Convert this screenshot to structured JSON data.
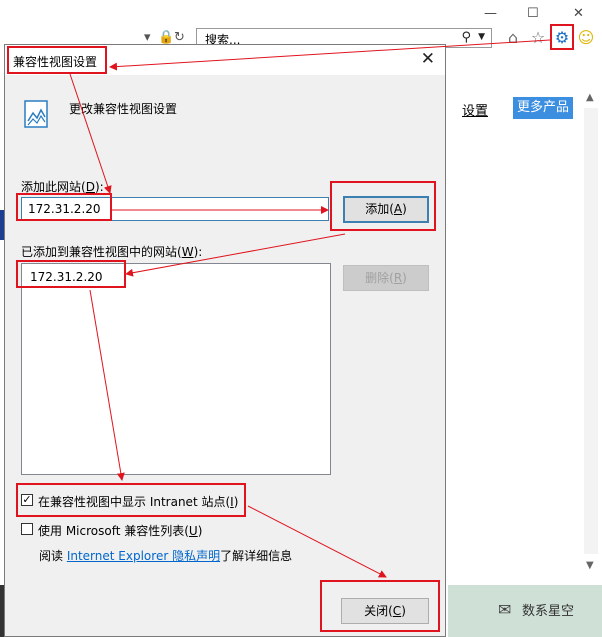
{
  "browser": {
    "address_text": "搜索...",
    "minimize_glyph": "—",
    "maximize_glyph": "☐",
    "close_glyph": "✕",
    "home_icon": "home-icon",
    "star_icon": "star-icon",
    "gear_icon": "gear-icon",
    "smiley_icon": "smiley-icon",
    "settings_link": "设置",
    "more_products": "更多产品",
    "watermark_text": "数系星空"
  },
  "dialog": {
    "title": "兼容性视图设置",
    "header_text": "更改兼容性视图设置",
    "add_site": {
      "label": "添加此网站(",
      "accel": "D",
      "label_end": "):",
      "value": "172.31.2.20",
      "button_label": "添加(",
      "button_accel": "A",
      "button_end": ")"
    },
    "added_sites": {
      "label": "已添加到兼容性视图中的网站(",
      "accel": "W",
      "label_end": "):",
      "items": [
        "172.31.2.20"
      ],
      "remove_label": "删除(",
      "remove_accel": "R",
      "remove_end": ")"
    },
    "options": {
      "intranet_label": "在兼容性视图中显示 Intranet 站点(",
      "intranet_accel": "I",
      "intranet_end": ")",
      "intranet_checked": true,
      "mslist_label": "使用 Microsoft 兼容性列表(",
      "mslist_accel": "U",
      "mslist_end": ")",
      "mslist_checked": false
    },
    "privacy": {
      "prefix": "阅读 ",
      "link": "Internet Explorer 隐私声明",
      "suffix": "了解详细信息"
    },
    "close_button": {
      "label": "关闭(",
      "accel": "C",
      "end": ")"
    }
  },
  "colors": {
    "annotation": "#e0141e",
    "accent": "#3c7fb1",
    "gear": "#1a6fc7"
  }
}
